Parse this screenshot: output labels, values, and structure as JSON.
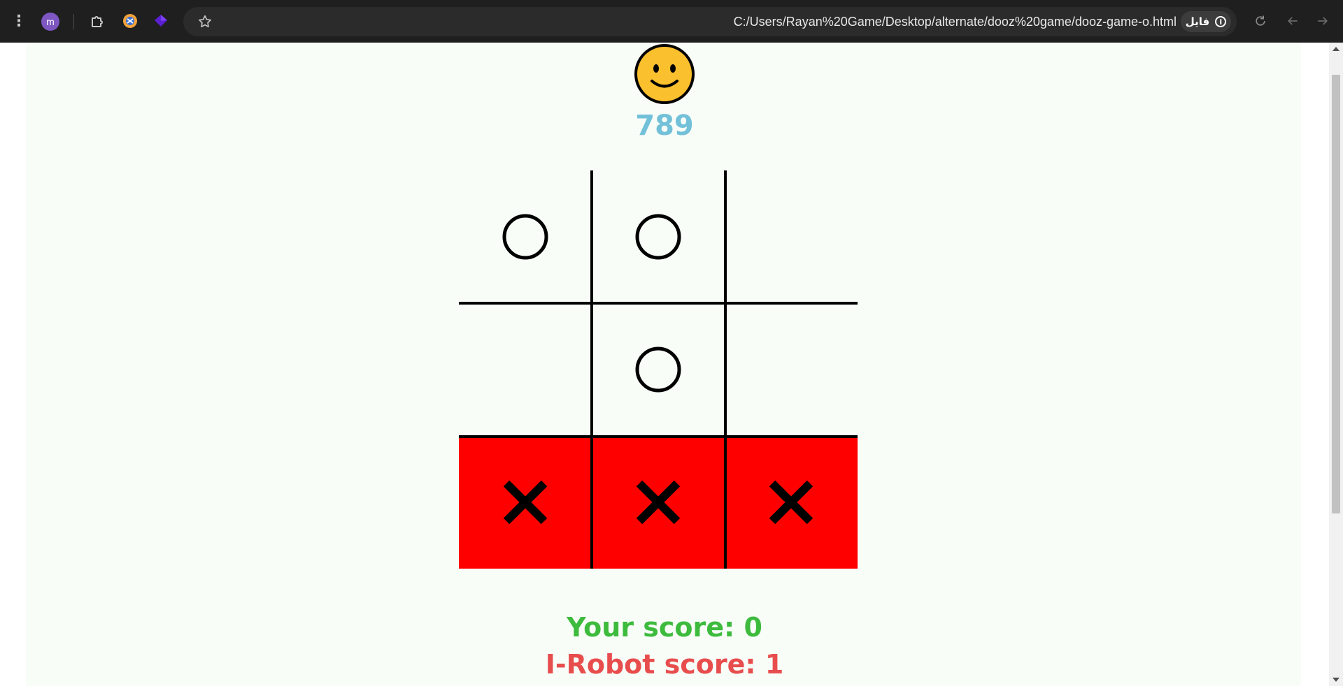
{
  "browser": {
    "avatar_letter": "m",
    "url": "C:/Users/Rayan%20Game/Desktop/alternate/dooz%20game/dooz-game-o.html",
    "site_chip_label": "فایل",
    "icons": [
      "menu-icon",
      "profile-avatar",
      "extensions-icon",
      "extension-colorful-icon",
      "extension-diamond-icon",
      "bookmark-star-icon",
      "site-info-icon",
      "reload-icon",
      "back-icon",
      "forward-icon"
    ]
  },
  "game": {
    "status_emoji": "smiley-face-icon",
    "counter": "789",
    "board": [
      [
        "O",
        "O",
        ""
      ],
      [
        "",
        "O",
        ""
      ],
      [
        "X",
        "X",
        "X"
      ]
    ],
    "winning_row": 2,
    "colors": {
      "win_highlight": "#ff0000",
      "counter": "#72c1d9",
      "your_score": "#3dbb3d",
      "robot_score": "#e84d4d",
      "background": "#f8fdf8"
    },
    "your_score_text": "Your score: 0",
    "robot_score_text": "I-Robot score: 1"
  }
}
